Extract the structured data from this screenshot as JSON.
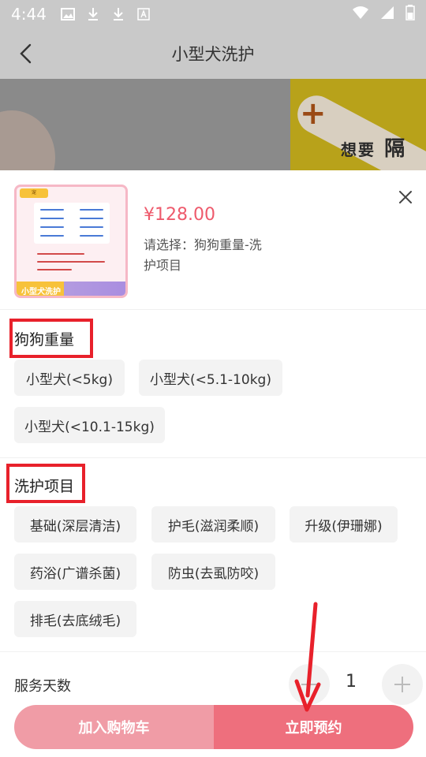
{
  "status_bar": {
    "time": "4:44"
  },
  "header": {
    "title": "小型犬洗护"
  },
  "banner": {
    "text_big": "想要",
    "text_big2": "隔"
  },
  "product": {
    "price": "¥128.00",
    "choose_label": "请选择：狗狗重量-洗护项目",
    "thumb_tag": "小型犬洗护"
  },
  "weight": {
    "title": "狗狗重量",
    "options": [
      "小型犬(<5kg)",
      "小型犬(<5.1-10kg)",
      "小型犬(<10.1-15kg)"
    ]
  },
  "care": {
    "title": "洗护项目",
    "options": [
      "基础(深层清洁)",
      "护毛(滋润柔顺)",
      "升级(伊珊娜)",
      "药浴(广谱杀菌)",
      "防虫(去虱防咬)",
      "排毛(去底绒毛)"
    ]
  },
  "service_days": {
    "label": "服务天数",
    "value": "1"
  },
  "actions": {
    "add_cart": "加入购物车",
    "book_now": "立即预约"
  },
  "colors": {
    "accent": "#ee6f7d",
    "price": "#ee5a6c",
    "highlight_box": "#e8212b"
  }
}
